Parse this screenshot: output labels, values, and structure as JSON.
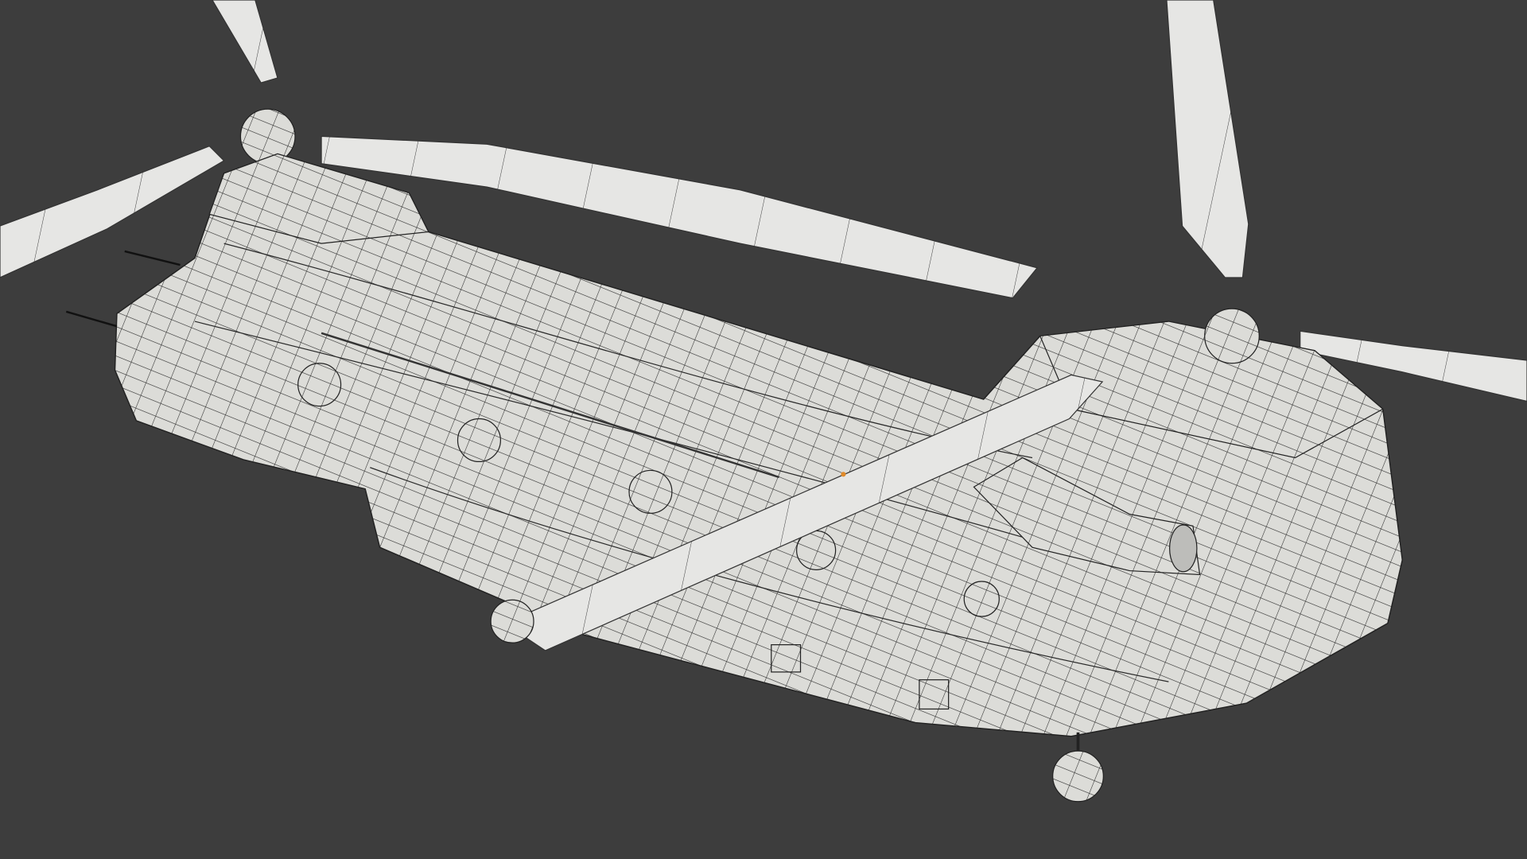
{
  "viewport": {
    "mode": "wireframe-on-solid",
    "background_color": "#3d3d3d",
    "mesh_fill_color": "#dcdcd8",
    "wire_color": "#2a2a2a",
    "origin_color": "#e08a2a"
  }
}
